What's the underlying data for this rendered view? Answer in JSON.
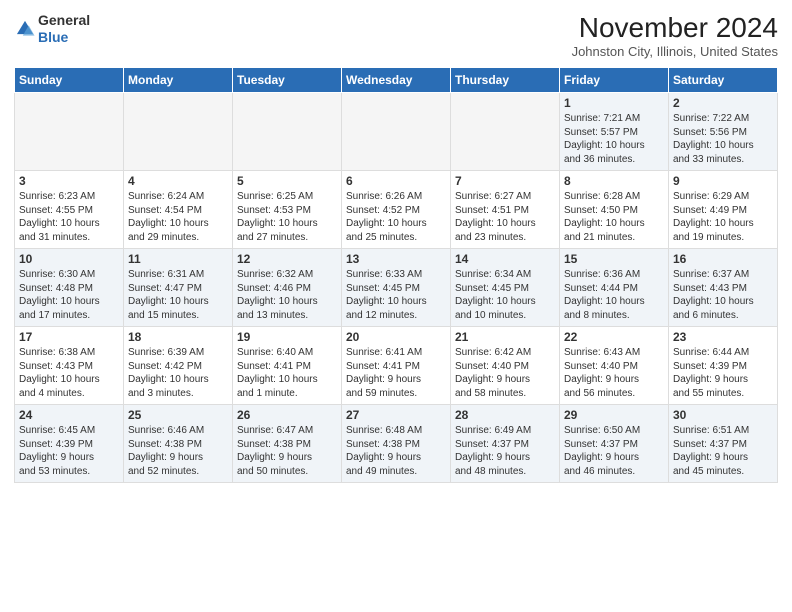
{
  "header": {
    "logo_line1": "General",
    "logo_line2": "Blue",
    "month_title": "November 2024",
    "location": "Johnston City, Illinois, United States"
  },
  "days_of_week": [
    "Sunday",
    "Monday",
    "Tuesday",
    "Wednesday",
    "Thursday",
    "Friday",
    "Saturday"
  ],
  "weeks": [
    [
      {
        "day": "",
        "info": ""
      },
      {
        "day": "",
        "info": ""
      },
      {
        "day": "",
        "info": ""
      },
      {
        "day": "",
        "info": ""
      },
      {
        "day": "",
        "info": ""
      },
      {
        "day": "1",
        "info": "Sunrise: 7:21 AM\nSunset: 5:57 PM\nDaylight: 10 hours\nand 36 minutes."
      },
      {
        "day": "2",
        "info": "Sunrise: 7:22 AM\nSunset: 5:56 PM\nDaylight: 10 hours\nand 33 minutes."
      }
    ],
    [
      {
        "day": "3",
        "info": "Sunrise: 6:23 AM\nSunset: 4:55 PM\nDaylight: 10 hours\nand 31 minutes."
      },
      {
        "day": "4",
        "info": "Sunrise: 6:24 AM\nSunset: 4:54 PM\nDaylight: 10 hours\nand 29 minutes."
      },
      {
        "day": "5",
        "info": "Sunrise: 6:25 AM\nSunset: 4:53 PM\nDaylight: 10 hours\nand 27 minutes."
      },
      {
        "day": "6",
        "info": "Sunrise: 6:26 AM\nSunset: 4:52 PM\nDaylight: 10 hours\nand 25 minutes."
      },
      {
        "day": "7",
        "info": "Sunrise: 6:27 AM\nSunset: 4:51 PM\nDaylight: 10 hours\nand 23 minutes."
      },
      {
        "day": "8",
        "info": "Sunrise: 6:28 AM\nSunset: 4:50 PM\nDaylight: 10 hours\nand 21 minutes."
      },
      {
        "day": "9",
        "info": "Sunrise: 6:29 AM\nSunset: 4:49 PM\nDaylight: 10 hours\nand 19 minutes."
      }
    ],
    [
      {
        "day": "10",
        "info": "Sunrise: 6:30 AM\nSunset: 4:48 PM\nDaylight: 10 hours\nand 17 minutes."
      },
      {
        "day": "11",
        "info": "Sunrise: 6:31 AM\nSunset: 4:47 PM\nDaylight: 10 hours\nand 15 minutes."
      },
      {
        "day": "12",
        "info": "Sunrise: 6:32 AM\nSunset: 4:46 PM\nDaylight: 10 hours\nand 13 minutes."
      },
      {
        "day": "13",
        "info": "Sunrise: 6:33 AM\nSunset: 4:45 PM\nDaylight: 10 hours\nand 12 minutes."
      },
      {
        "day": "14",
        "info": "Sunrise: 6:34 AM\nSunset: 4:45 PM\nDaylight: 10 hours\nand 10 minutes."
      },
      {
        "day": "15",
        "info": "Sunrise: 6:36 AM\nSunset: 4:44 PM\nDaylight: 10 hours\nand 8 minutes."
      },
      {
        "day": "16",
        "info": "Sunrise: 6:37 AM\nSunset: 4:43 PM\nDaylight: 10 hours\nand 6 minutes."
      }
    ],
    [
      {
        "day": "17",
        "info": "Sunrise: 6:38 AM\nSunset: 4:43 PM\nDaylight: 10 hours\nand 4 minutes."
      },
      {
        "day": "18",
        "info": "Sunrise: 6:39 AM\nSunset: 4:42 PM\nDaylight: 10 hours\nand 3 minutes."
      },
      {
        "day": "19",
        "info": "Sunrise: 6:40 AM\nSunset: 4:41 PM\nDaylight: 10 hours\nand 1 minute."
      },
      {
        "day": "20",
        "info": "Sunrise: 6:41 AM\nSunset: 4:41 PM\nDaylight: 9 hours\nand 59 minutes."
      },
      {
        "day": "21",
        "info": "Sunrise: 6:42 AM\nSunset: 4:40 PM\nDaylight: 9 hours\nand 58 minutes."
      },
      {
        "day": "22",
        "info": "Sunrise: 6:43 AM\nSunset: 4:40 PM\nDaylight: 9 hours\nand 56 minutes."
      },
      {
        "day": "23",
        "info": "Sunrise: 6:44 AM\nSunset: 4:39 PM\nDaylight: 9 hours\nand 55 minutes."
      }
    ],
    [
      {
        "day": "24",
        "info": "Sunrise: 6:45 AM\nSunset: 4:39 PM\nDaylight: 9 hours\nand 53 minutes."
      },
      {
        "day": "25",
        "info": "Sunrise: 6:46 AM\nSunset: 4:38 PM\nDaylight: 9 hours\nand 52 minutes."
      },
      {
        "day": "26",
        "info": "Sunrise: 6:47 AM\nSunset: 4:38 PM\nDaylight: 9 hours\nand 50 minutes."
      },
      {
        "day": "27",
        "info": "Sunrise: 6:48 AM\nSunset: 4:38 PM\nDaylight: 9 hours\nand 49 minutes."
      },
      {
        "day": "28",
        "info": "Sunrise: 6:49 AM\nSunset: 4:37 PM\nDaylight: 9 hours\nand 48 minutes."
      },
      {
        "day": "29",
        "info": "Sunrise: 6:50 AM\nSunset: 4:37 PM\nDaylight: 9 hours\nand 46 minutes."
      },
      {
        "day": "30",
        "info": "Sunrise: 6:51 AM\nSunset: 4:37 PM\nDaylight: 9 hours\nand 45 minutes."
      }
    ]
  ]
}
